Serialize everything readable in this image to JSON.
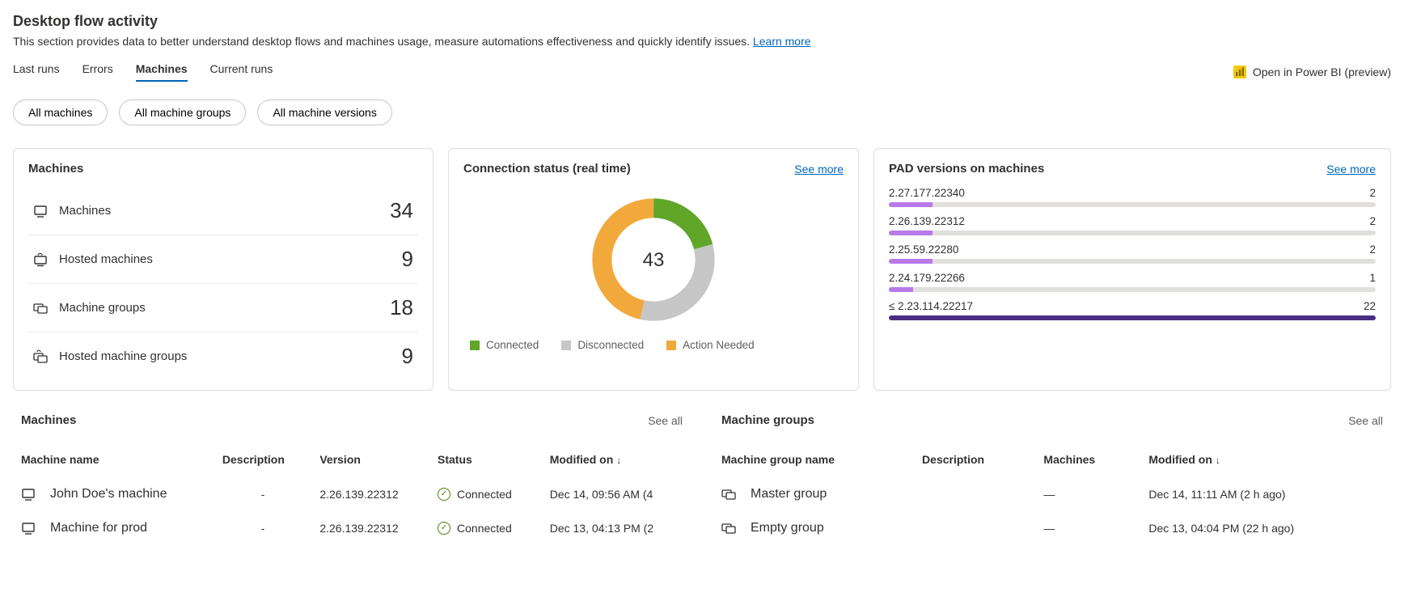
{
  "header": {
    "title": "Desktop flow activity",
    "subtitle_prefix": "This section provides data to better understand desktop flows and machines usage, measure automations effectiveness and quickly identify issues. ",
    "learn_more": "Learn more"
  },
  "tabs": {
    "items": [
      "Last runs",
      "Errors",
      "Machines",
      "Current runs"
    ],
    "active_index": 2
  },
  "open_powerbi": "Open in Power BI (preview)",
  "filters": [
    "All machines",
    "All machine groups",
    "All machine versions"
  ],
  "machines_card": {
    "title": "Machines",
    "items": [
      {
        "icon": "desktop-icon",
        "label": "Machines",
        "value": "34"
      },
      {
        "icon": "cloud-desktop-icon",
        "label": "Hosted machines",
        "value": "9"
      },
      {
        "icon": "desktop-group-icon",
        "label": "Machine groups",
        "value": "18"
      },
      {
        "icon": "cloud-group-icon",
        "label": "Hosted machine groups",
        "value": "9"
      }
    ]
  },
  "connection_card": {
    "title": "Connection status (real time)",
    "see_more": "See more",
    "center_value": "43",
    "legend": [
      {
        "label": "Connected",
        "color": "#5fa629"
      },
      {
        "label": "Disconnected",
        "color": "#c6c6c6"
      },
      {
        "label": "Action Needed",
        "color": "#f2a93b"
      }
    ]
  },
  "pad_card": {
    "title": "PAD versions on machines",
    "see_more": "See more",
    "items": [
      {
        "label": "2.27.177.22340",
        "value": "2",
        "pct": 9,
        "color": "#b87ae8"
      },
      {
        "label": "2.26.139.22312",
        "value": "2",
        "pct": 9,
        "color": "#b87ae8"
      },
      {
        "label": "2.25.59.22280",
        "value": "2",
        "pct": 9,
        "color": "#b87ae8"
      },
      {
        "label": "2.24.179.22266",
        "value": "1",
        "pct": 5,
        "color": "#b87ae8"
      },
      {
        "label": "≤ 2.23.114.22217",
        "value": "22",
        "pct": 100,
        "color": "#4b2e83"
      }
    ]
  },
  "machines_table": {
    "title": "Machines",
    "see_all": "See all",
    "columns": [
      "Machine name",
      "Description",
      "Version",
      "Status",
      "Modified on"
    ],
    "sort_col_index": 4,
    "rows": [
      {
        "icon": "desktop-icon",
        "name": "John Doe's machine",
        "description": "-",
        "version": "2.26.139.22312",
        "status": "Connected",
        "modified": "Dec 14, 09:56 AM (4"
      },
      {
        "icon": "desktop-icon",
        "name": "Machine for prod",
        "description": "-",
        "version": "2.26.139.22312",
        "status": "Connected",
        "modified": "Dec 13, 04:13 PM (2"
      }
    ]
  },
  "groups_table": {
    "title": "Machine groups",
    "see_all": "See all",
    "columns": [
      "Machine group name",
      "Description",
      "Machines",
      "Modified on"
    ],
    "sort_col_index": 3,
    "rows": [
      {
        "icon": "desktop-group-icon",
        "name": "Master group",
        "description": "",
        "machines": "—",
        "modified": "Dec 14, 11:11 AM (2 h ago)"
      },
      {
        "icon": "desktop-group-icon",
        "name": "Empty group",
        "description": "",
        "machines": "—",
        "modified": "Dec 13, 04:04 PM (22 h ago)"
      }
    ]
  },
  "chart_data": {
    "type": "pie",
    "title": "Connection status (real time)",
    "center_total": 43,
    "series": [
      {
        "name": "Connected",
        "value": 9,
        "color": "#5fa629"
      },
      {
        "name": "Disconnected",
        "value": 14,
        "color": "#c6c6c6"
      },
      {
        "name": "Action Needed",
        "value": 20,
        "color": "#f2a93b"
      }
    ]
  }
}
